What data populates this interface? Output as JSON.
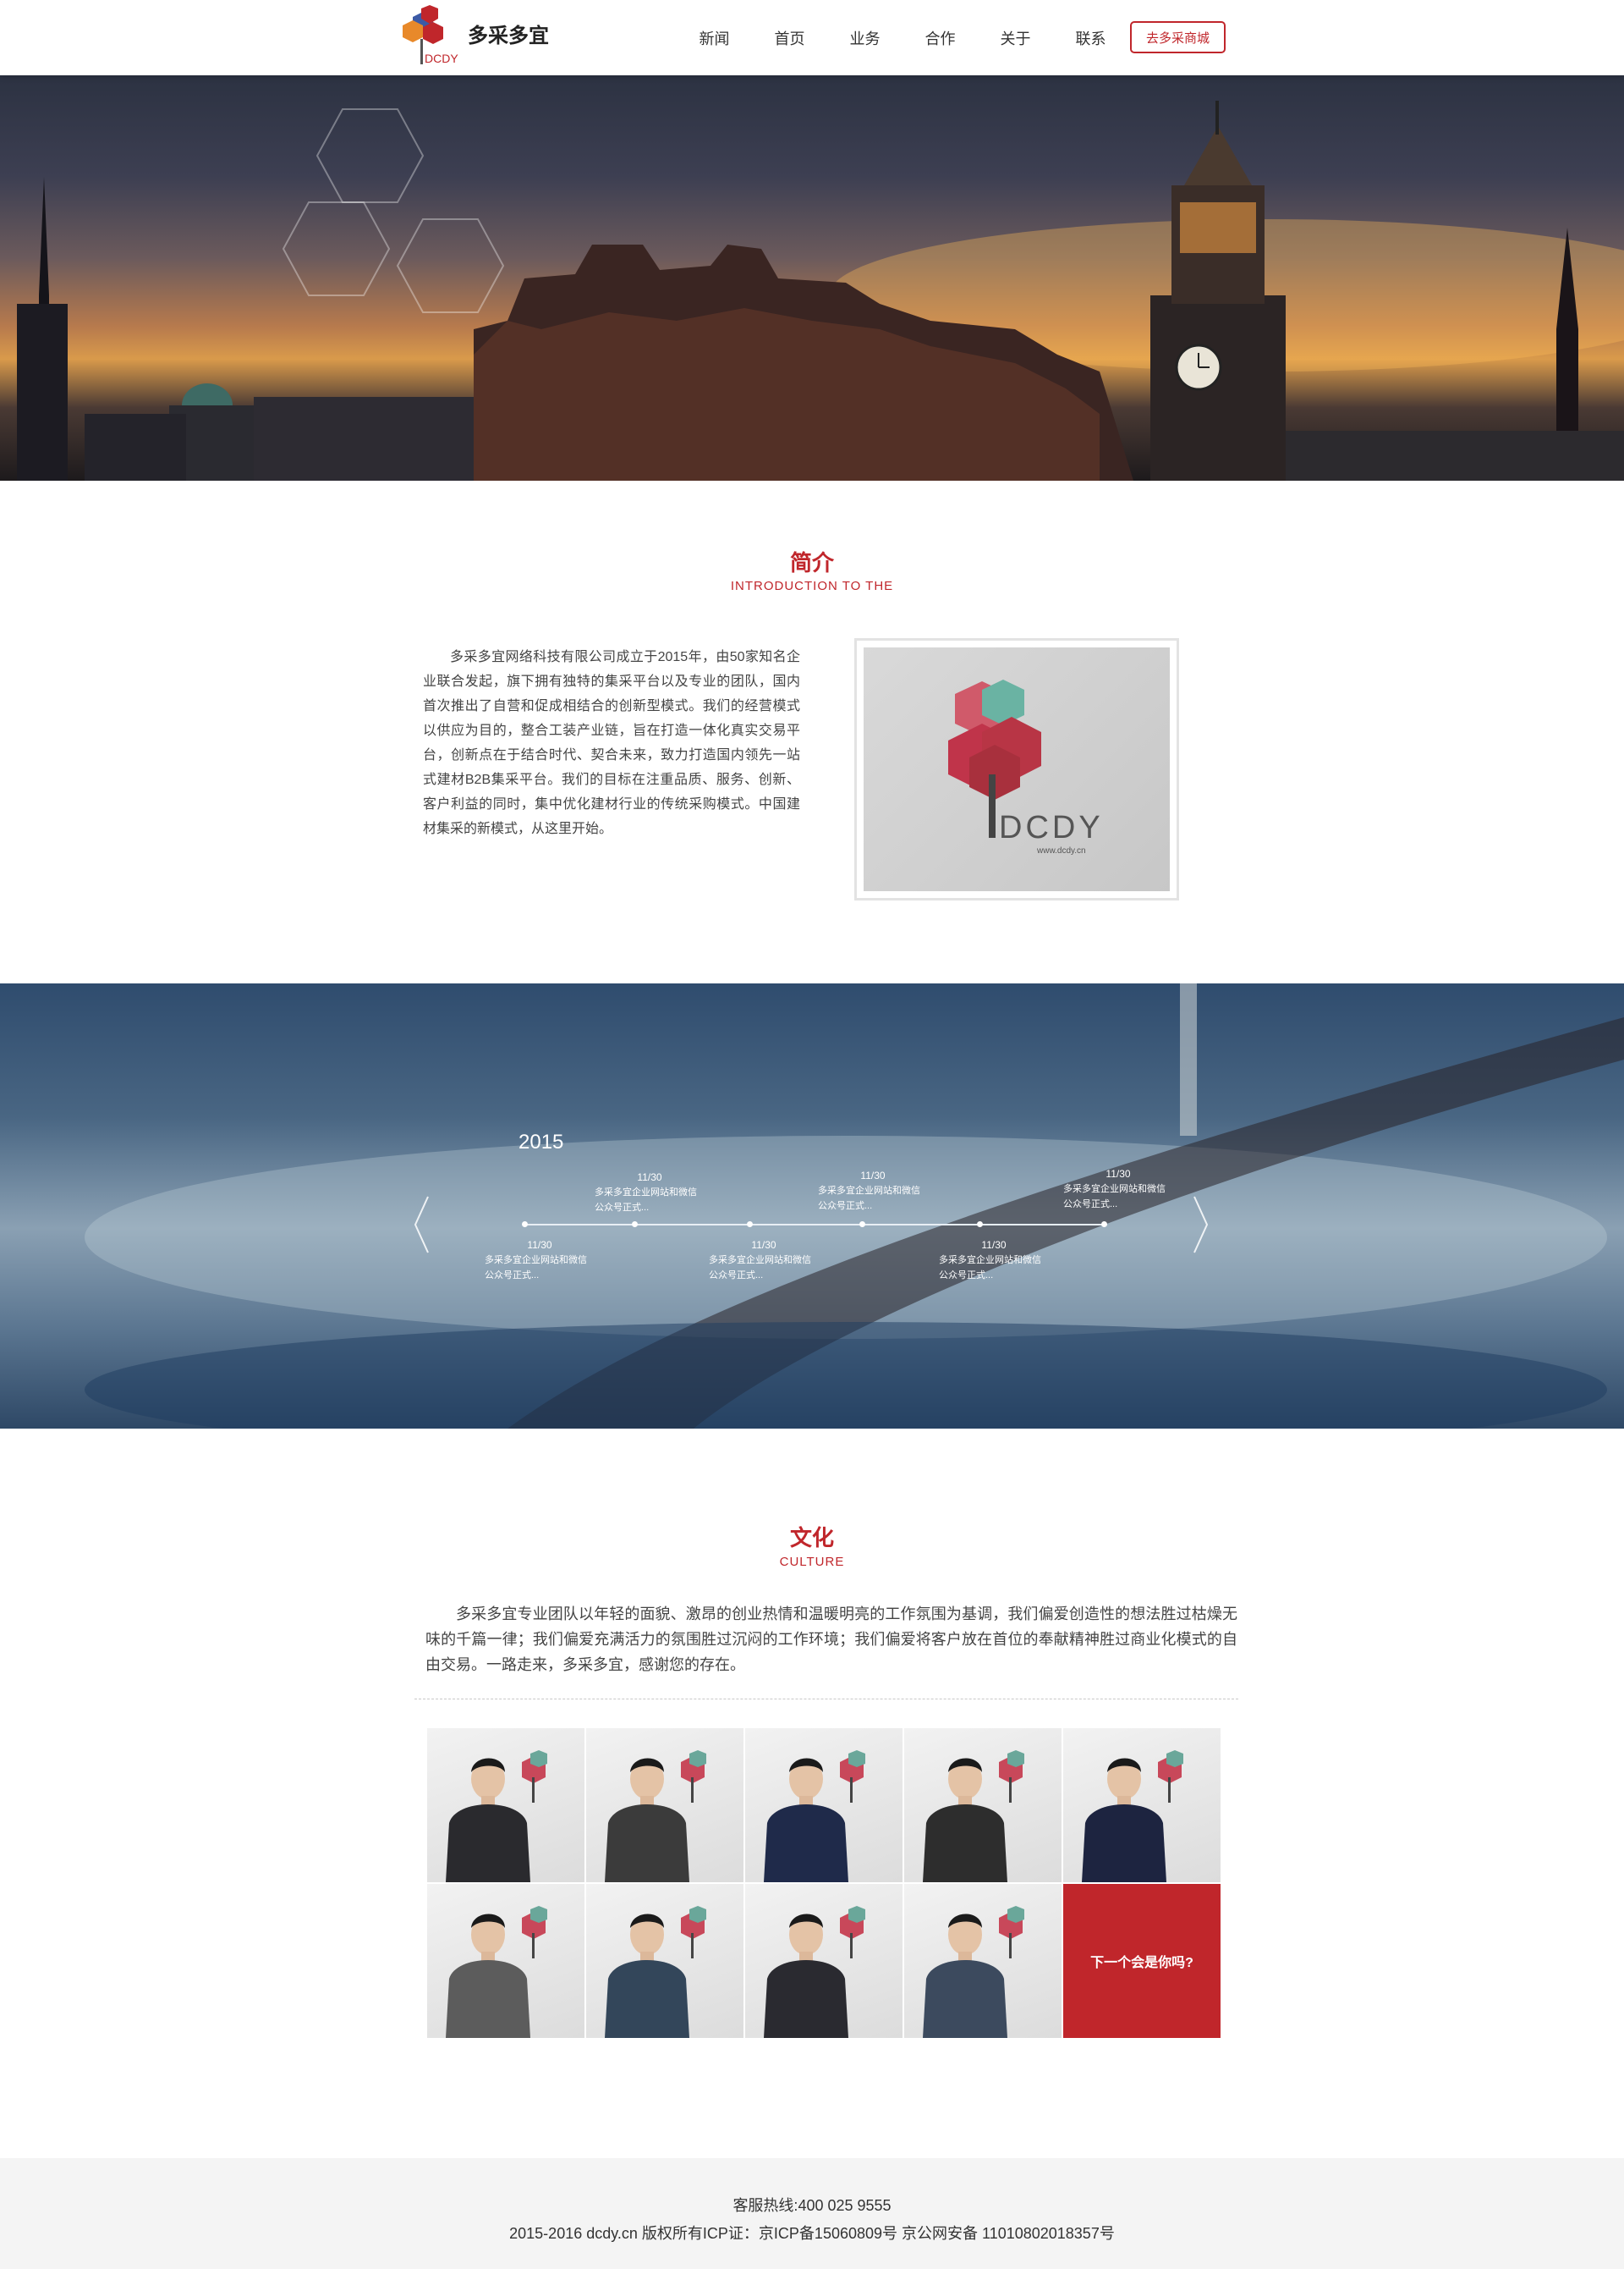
{
  "header": {
    "brand": "多采多宜",
    "logo_text": "DCDY",
    "nav": [
      "新闻",
      "首页",
      "业务",
      "合作",
      "关于",
      "联系"
    ],
    "mall_button": "去多采商城"
  },
  "intro": {
    "title": "简介",
    "subtitle": "INTRODUCTION TO THE",
    "text": "多采多宜网络科技有限公司成立于2015年，由50家知名企业联合发起，旗下拥有独特的集采平台以及专业的团队，国内首次推出了自营和促成相结合的创新型模式。我们的经营模式以供应为目的，整合工装产业链，旨在打造一体化真实交易平台，创新点在于结合时代、契合未来，致力打造国内领先一站式建材B2B集采平台。我们的目标在注重品质、服务、创新、客户利益的同时，集中优化建材行业的传统采购模式。中国建材集采的新模式，从这里开始。",
    "photo_logo": "DCDY",
    "photo_url": "www.dcdy.cn"
  },
  "timeline": {
    "year": "2015",
    "events": [
      {
        "date": "11/30",
        "text": "多采多宜企业网站和微信公众号正式..."
      },
      {
        "date": "11/30",
        "text": "多采多宜企业网站和微信公众号正式..."
      },
      {
        "date": "11/30",
        "text": "多采多宜企业网站和微信公众号正式..."
      },
      {
        "date": "11/30",
        "text": "多采多宜企业网站和微信公众号正式..."
      },
      {
        "date": "11/30",
        "text": "多采多宜企业网站和微信公众号正式..."
      },
      {
        "date": "11/30",
        "text": "多采多宜企业网站和微信公众号正式..."
      }
    ]
  },
  "culture": {
    "title": "文化",
    "subtitle": "CULTURE",
    "text": "多采多宜专业团队以年轻的面貌、激昂的创业热情和温暖明亮的工作氛围为基调，我们偏爱创造性的想法胜过枯燥无味的千篇一律；我们偏爱充满活力的氛围胜过沉闷的工作环境；我们偏爱将客户放在首位的奉献精神胜过商业化模式的自由交易。一路走来，多采多宜，感谢您的存在。",
    "cta": "下一个会是你吗?"
  },
  "footer": {
    "hotline": "客服热线:400 025 9555",
    "copyright": "2015-2016 dcdy.cn 版权所有ICP证：京ICP备15060809号 京公网安备   11010802018357号"
  },
  "colors": {
    "accent": "#c0262b"
  }
}
